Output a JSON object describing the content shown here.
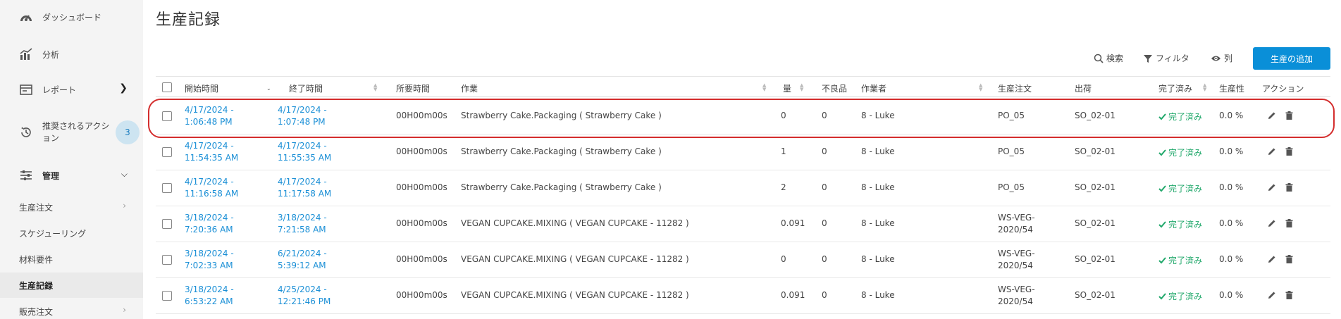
{
  "sidebar": {
    "items": [
      {
        "label": "ダッシュボード",
        "icon": "dashboard-gauge-icon"
      },
      {
        "label": "分析",
        "icon": "analytics-chart-icon"
      },
      {
        "label": "レポート",
        "icon": "report-icon"
      },
      {
        "label": "推奨されるアクション",
        "icon": "history-clock-icon",
        "badge": "3"
      },
      {
        "label": "管理",
        "icon": "sliders-icon"
      }
    ],
    "sub_items": [
      {
        "label": "生産注文"
      },
      {
        "label": "スケジューリング"
      },
      {
        "label": "材料要件"
      },
      {
        "label": "生産記録"
      },
      {
        "label": "販売注文"
      }
    ]
  },
  "page": {
    "title": "生産記録"
  },
  "toolbar": {
    "search_label": "検索",
    "filter_label": "フィルタ",
    "columns_label": "列",
    "add_label": "生産の追加"
  },
  "table": {
    "headers": [
      "開始時間",
      "終了時間",
      "所要時間",
      "作業",
      "量",
      "不良品",
      "作業者",
      "生産注文",
      "出荷",
      "完了済み",
      "生産性",
      "アクション"
    ],
    "rows": [
      {
        "start1": "4/17/2024 -",
        "start2": "1:06:48 PM",
        "end1": "4/17/2024 -",
        "end2": "1:07:48 PM",
        "duration": "00H00m00s",
        "operation": "Strawberry Cake.Packaging ( Strawberry Cake )",
        "qty": "0",
        "defects": "0",
        "operator": "8 - Luke",
        "order1": "PO_05",
        "order2": "",
        "shipment": "SO_02-01",
        "status": "完了済み",
        "productivity": "0.0 %"
      },
      {
        "start1": "4/17/2024 -",
        "start2": "11:54:35 AM",
        "end1": "4/17/2024 -",
        "end2": "11:55:35 AM",
        "duration": "00H00m00s",
        "operation": "Strawberry Cake.Packaging ( Strawberry Cake )",
        "qty": "1",
        "defects": "0",
        "operator": "8 - Luke",
        "order1": "PO_05",
        "order2": "",
        "shipment": "SO_02-01",
        "status": "完了済み",
        "productivity": "0.0 %"
      },
      {
        "start1": "4/17/2024 -",
        "start2": "11:16:58 AM",
        "end1": "4/17/2024 -",
        "end2": "11:17:58 AM",
        "duration": "00H00m00s",
        "operation": "Strawberry Cake.Packaging ( Strawberry Cake )",
        "qty": "2",
        "defects": "0",
        "operator": "8 - Luke",
        "order1": "PO_05",
        "order2": "",
        "shipment": "SO_02-01",
        "status": "完了済み",
        "productivity": "0.0 %"
      },
      {
        "start1": "3/18/2024 -",
        "start2": "7:20:36 AM",
        "end1": "3/18/2024 -",
        "end2": "7:21:58 AM",
        "duration": "00H00m00s",
        "operation": "VEGAN CUPCAKE.MIXING ( VEGAN CUPCAKE - 11282 )",
        "qty": "0.091",
        "defects": "0",
        "operator": "8 - Luke",
        "order1": "WS-VEG-",
        "order2": "2020/54",
        "shipment": "SO_02-01",
        "status": "完了済み",
        "productivity": "0.0 %"
      },
      {
        "start1": "3/18/2024 -",
        "start2": "7:02:33 AM",
        "end1": "6/21/2024 -",
        "end2": "5:39:12 AM",
        "duration": "00H00m00s",
        "operation": "VEGAN CUPCAKE.MIXING ( VEGAN CUPCAKE - 11282 )",
        "qty": "0",
        "defects": "0",
        "operator": "8 - Luke",
        "order1": "WS-VEG-",
        "order2": "2020/54",
        "shipment": "SO_02-01",
        "status": "完了済み",
        "productivity": "0.0 %"
      },
      {
        "start1": "3/18/2024 -",
        "start2": "6:53:22 AM",
        "end1": "4/25/2024 -",
        "end2": "12:21:46 PM",
        "duration": "00H00m00s",
        "operation": "VEGAN CUPCAKE.MIXING ( VEGAN CUPCAKE - 11282 )",
        "qty": "0.091",
        "defects": "0",
        "operator": "8 - Luke",
        "order1": "WS-VEG-",
        "order2": "2020/54",
        "shipment": "SO_02-01",
        "status": "完了済み",
        "productivity": "0.0 %"
      }
    ]
  },
  "colors": {
    "accent": "#0a8fd8",
    "link": "#1a8fd6",
    "done": "#21a86b",
    "highlight": "#d42d2d"
  }
}
